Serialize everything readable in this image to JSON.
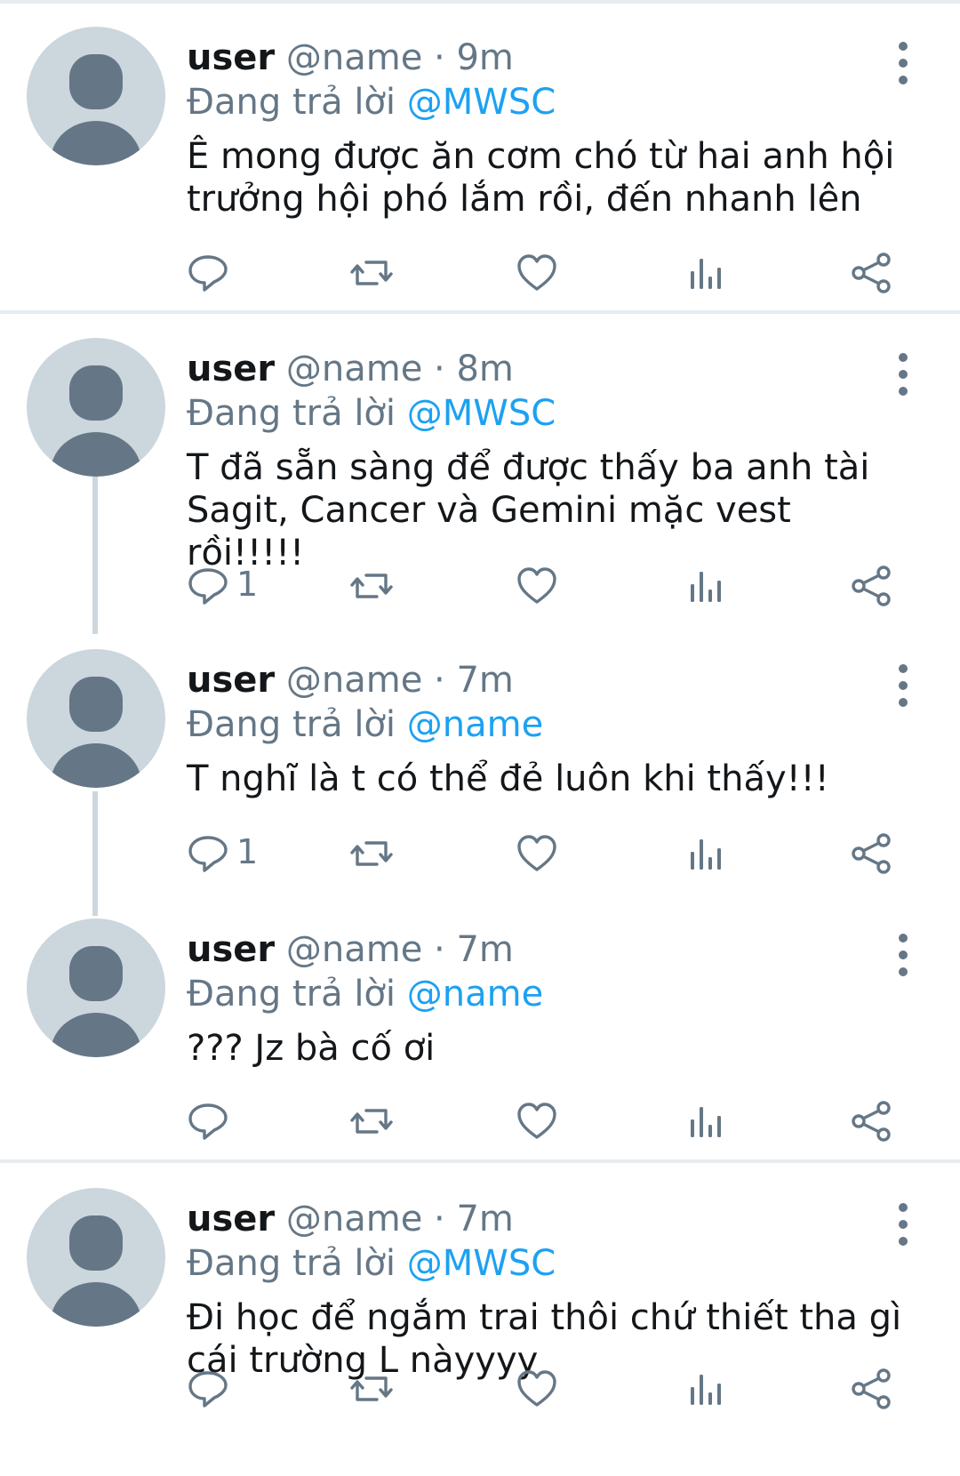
{
  "tweets": [
    {
      "user": "user",
      "handle": "@name",
      "sep": "·",
      "time": "9m",
      "reply_prefix": "Đang trả lời",
      "reply_to": "@MWSC",
      "text": "Ê mong được ăn cơm chó từ hai anh hội trưởng hội phó lắm rồi, đến nhanh lên",
      "reply_count": ""
    },
    {
      "user": "user",
      "handle": "@name",
      "sep": "·",
      "time": "8m",
      "reply_prefix": "Đang trả lời",
      "reply_to": "@MWSC",
      "text": "T đã sẵn sàng để được thấy ba anh tài Sagit, Cancer và Gemini mặc vest rồi!!!!!",
      "reply_count": "1"
    },
    {
      "user": "user",
      "handle": "@name",
      "sep": "·",
      "time": "7m",
      "reply_prefix": "Đang trả lời",
      "reply_to": "@name",
      "text": "T nghĩ là t có thể đẻ luôn khi thấy!!!",
      "reply_count": "1"
    },
    {
      "user": "user",
      "handle": "@name",
      "sep": "·",
      "time": "7m",
      "reply_prefix": "Đang trả lời",
      "reply_to": "@name",
      "text": "??? Jz bà cố ơi",
      "reply_count": ""
    },
    {
      "user": "user",
      "handle": "@name",
      "sep": "·",
      "time": "7m",
      "reply_prefix": "Đang trả lời",
      "reply_to": "@MWSC",
      "text": "Đi học để ngắm trai thôi chứ thiết tha gì cái trường L nàyyyy",
      "reply_count": ""
    }
  ],
  "icons": {
    "reply": "reply-icon",
    "retweet": "retweet-icon",
    "like": "like-icon",
    "analytics": "analytics-icon",
    "share": "share-icon",
    "more": "more-vertical-icon"
  },
  "colors": {
    "accent": "#1da1f2",
    "muted": "#657786",
    "avatar_bg": "#ccd6dd",
    "divider": "#e6ecf0"
  }
}
